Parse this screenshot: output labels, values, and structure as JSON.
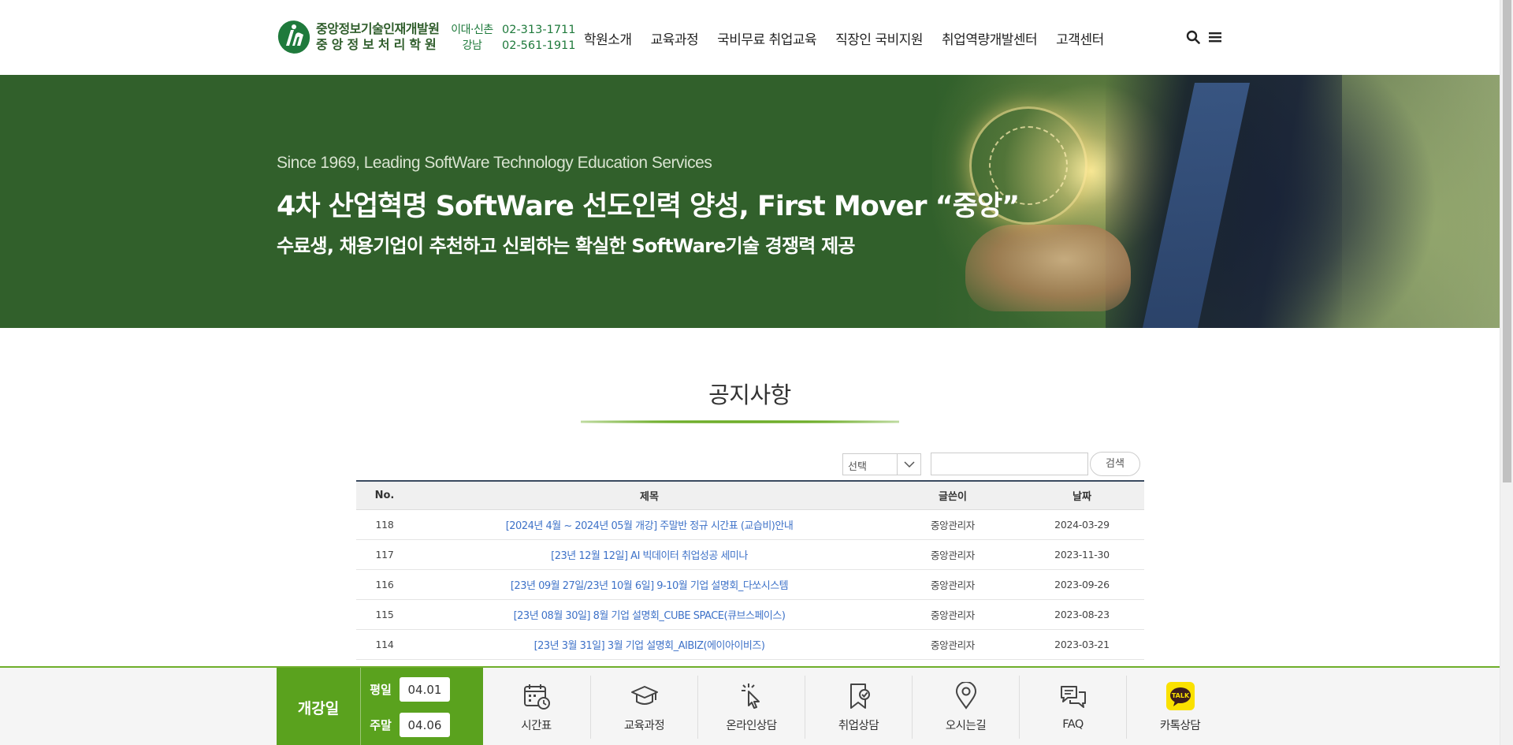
{
  "header": {
    "logo_line1": "중앙정보기술인재개발원",
    "logo_line2": "중앙정보처리학원",
    "phones": [
      {
        "area": "이대·신촌",
        "number": "02-313-1711"
      },
      {
        "area": "강남",
        "number": "02-561-1911"
      }
    ],
    "nav": [
      "학원소개",
      "교육과정",
      "국비무료 취업교육",
      "직장인 국비지원",
      "취업역량개발센터",
      "고객센터"
    ]
  },
  "hero": {
    "subtitle": "Since 1969, Leading SoftWare Technology Education Services",
    "title": "4차 산업혁명 SoftWare 선도인력 양성, First Mover “중앙”",
    "description": "수료생, 채용기업이 추천하고 신뢰하는 확실한 SoftWare기술 경쟁력 제공"
  },
  "notice": {
    "title": "공지사항",
    "select_value": "선택",
    "search_button": "검색",
    "columns": {
      "no": "No.",
      "title": "제목",
      "writer": "글쓴이",
      "date": "날짜"
    },
    "rows": [
      {
        "no": "118",
        "title": "[2024년 4월 ~ 2024년 05월 개강] 주말반 정규 시간표 (교습비)안내",
        "writer": "중앙관리자",
        "date": "2024-03-29"
      },
      {
        "no": "117",
        "title": "[23년 12월 12일] AI 빅데이터 취업성공 세미나",
        "writer": "중앙관리자",
        "date": "2023-11-30"
      },
      {
        "no": "116",
        "title": "[23년 09월 27일/23년 10월 6일] 9-10월 기업 설명회_다쏘시스템",
        "writer": "중앙관리자",
        "date": "2023-09-26"
      },
      {
        "no": "115",
        "title": "[23년 08월 30일] 8월 기업 설명회_CUBE SPACE(큐브스페이스)",
        "writer": "중앙관리자",
        "date": "2023-08-23"
      },
      {
        "no": "114",
        "title": "[23년 3월 31일] 3월 기업 설명회_AIBIZ(에이아이비즈)",
        "writer": "중앙관리자",
        "date": "2023-03-21"
      }
    ]
  },
  "bottom": {
    "open_label": "개강일",
    "weekday_label": "평일",
    "weekday_date": "04.01",
    "weekend_label": "주말",
    "weekend_date": "04.06",
    "quick": [
      {
        "label": "시간표",
        "icon": "calendar-clock-icon"
      },
      {
        "label": "교육과정",
        "icon": "graduation-cap-icon"
      },
      {
        "label": "온라인상담",
        "icon": "pointer-click-icon"
      },
      {
        "label": "취업상담",
        "icon": "badge-check-icon"
      },
      {
        "label": "오시는길",
        "icon": "map-pin-icon"
      },
      {
        "label": "FAQ",
        "icon": "chat-bubbles-icon"
      },
      {
        "label": "카톡상담",
        "icon": "kakaotalk-icon",
        "badge_text": "TALK"
      }
    ]
  },
  "colors": {
    "brand_green": "#31602b",
    "accent_green": "#5aa21e",
    "link_blue": "#3e72c8"
  }
}
